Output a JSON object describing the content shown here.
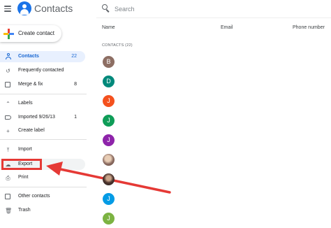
{
  "header": {
    "app_title": "Contacts",
    "menu_icon": "hamburger-menu-icon",
    "logo_icon": "contacts-logo-icon"
  },
  "search": {
    "placeholder": "Search"
  },
  "create_contact": {
    "label": "Create contact"
  },
  "sidebar": {
    "contacts": {
      "label": "Contacts",
      "count": "22"
    },
    "frequently_contacted": {
      "label": "Frequently contacted"
    },
    "merge_fix": {
      "label": "Merge & fix",
      "count": "8"
    },
    "labels_header": "Labels",
    "labels": [
      {
        "label": "Imported 9/26/13",
        "count": "1"
      }
    ],
    "create_label": {
      "label": "Create label"
    },
    "import": {
      "label": "Import"
    },
    "export": {
      "label": "Export"
    },
    "print": {
      "label": "Print"
    },
    "other_contacts": {
      "label": "Other contacts"
    },
    "trash": {
      "label": "Trash"
    }
  },
  "table": {
    "columns": {
      "name": "Name",
      "email": "Email",
      "phone": "Phone number"
    },
    "section_title": "CONTACTS (22)",
    "contacts": [
      {
        "initial": "B",
        "color": "#8d6e63"
      },
      {
        "initial": "D",
        "color": "#00897b"
      },
      {
        "initial": "J",
        "color": "#f4511e"
      },
      {
        "initial": "J",
        "color": "#0f9d58"
      },
      {
        "initial": "J",
        "color": "#8e24aa"
      },
      {
        "initial": "",
        "color": "photo"
      },
      {
        "initial": "",
        "color": "photo"
      },
      {
        "initial": "J",
        "color": "#039be5"
      },
      {
        "initial": "J",
        "color": "#7cb342"
      }
    ]
  },
  "annotation": {
    "highlight_color": "#e53935"
  }
}
